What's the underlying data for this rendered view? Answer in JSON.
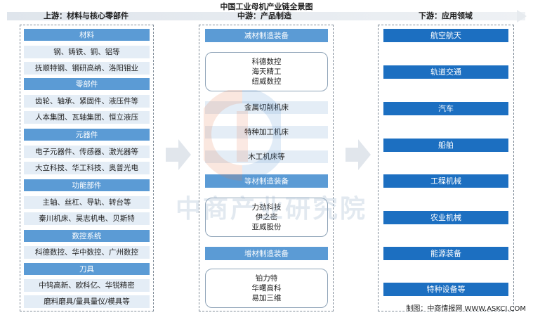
{
  "title": "中国工业母机产业链全景图",
  "headers": {
    "up": "上游：材料与核心零部件",
    "mid": "中游：产品制造",
    "down": "下游：应用领域"
  },
  "upstream": [
    {
      "category": "材料",
      "items": [
        "钢、铸铁、铜、铝等",
        "抚顺特钢、钢研高纳、洛阳钼业"
      ]
    },
    {
      "category": "零部件",
      "items": [
        "齿轮、轴承、紧固件、液压件等",
        "人本集团、瓦轴集团、恒立液压"
      ]
    },
    {
      "category": "元器件",
      "items": [
        "电子元器件、传感器、激光器等",
        "大立科技、华工科技、奥普光电"
      ]
    },
    {
      "category": "功能部件",
      "items": [
        "主轴、丝杠、导轨、转台等",
        "秦川机床、昊志机电、贝斯特"
      ]
    },
    {
      "category": "数控系统",
      "items": [
        "科德数控、华中数控、广州数控"
      ]
    },
    {
      "category": "刀具",
      "items": [
        "中钨高新、欧科亿、华锐精密",
        "磨料磨具/量具量仪/模具等"
      ]
    }
  ],
  "midstream": {
    "sub_header": "减材制造装备",
    "sub_companies": [
      "科德数控",
      "海天精工",
      "纽威数控"
    ],
    "sub_types": [
      "金属切削机床",
      "特种加工机床",
      "木工机床等"
    ],
    "equal_header": "等材制造装备",
    "equal_companies": [
      "力劲科技",
      "伊之密",
      "亚威股份"
    ],
    "add_header": "增材制造装备",
    "add_companies": [
      "铂力特",
      "华曙高科",
      "易加三维"
    ]
  },
  "downstream": [
    "航空航天",
    "轨道交通",
    "汽车",
    "船舶",
    "工程机械",
    "农业机械",
    "能源装备",
    "特种设备等"
  ],
  "watermark": "中商产业研究院",
  "source": "制图：中商情报网 WWW.ASKCI.COM",
  "colors": {
    "category": "#5b9bd5",
    "item_bg": "#e4edf6",
    "app": "#1c6fc1",
    "arrow": "#e1e6ec"
  }
}
